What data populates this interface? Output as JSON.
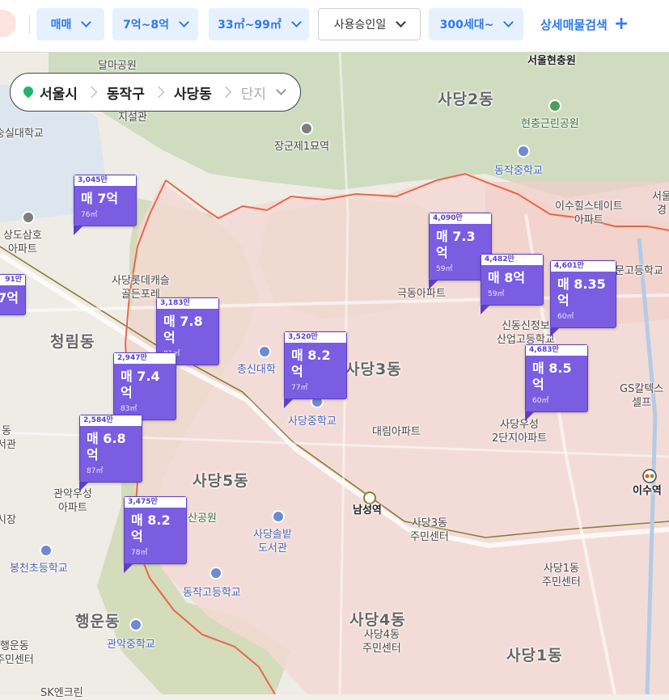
{
  "filters": {
    "deal_type": "매매",
    "price": "7억~8억",
    "area": "33㎡~99㎡",
    "approval": "사용승인일",
    "households": "300세대~",
    "detail_search": "상세매물검색"
  },
  "breadcrumb": {
    "city": "서울시",
    "district": "동작구",
    "dong": "사당동",
    "complex": "단지"
  },
  "map_labels": {
    "seoul_hyunchung": "서울현충원",
    "sadang2": "사당2동",
    "hyunchung_park": "현충근린공원",
    "janggunje": "장군제1묘역",
    "dongjak_ms": "동작중학교",
    "isu_hillstate": "이수힐스테이트\n아파트",
    "seoul_right": "서울\n경",
    "sangdo_samho": "상도삼호\n아파트",
    "sadang_lotte": "사당롯데캐슬\n골든포레",
    "geukdong": "극동아파트",
    "sindong_school": "신동신정보\n산업고등학교",
    "mungu": "문고등학교",
    "cheongnim": "청림동",
    "chongshin": "총신대학",
    "sadang3": "사당3동",
    "sadang_ms": "사당중학교",
    "daerim": "대림아파트",
    "sadang_usung": "사당우성\n2단지아파트",
    "gs": "GS칼텍스\n셀프",
    "seo_left": "동\n서관",
    "gwanak_usung": "관악우성\n아파트",
    "sadang5": "사당5동",
    "park": "산공원",
    "namseong": "남성역",
    "sadang3_center": "사당3동\n주민센터",
    "isu_station": "이수역",
    "si_jang": "시장",
    "sadang_library": "사당솔밭\n도서관",
    "bongcheon": "봉천초등학교",
    "sadang1_center": "사당1동\n주민센터",
    "dongjak_hs": "동작고등학교",
    "haengun": "행운동",
    "haengun_center": "행운동\n주민센터",
    "gwanak_ms": "관악중학교",
    "sadang4": "사당4동\n주민센터",
    "sadang4_area": "사당4동",
    "sadang1": "사당1동",
    "sk": "SK엔크린",
    "sungsil": "숭실대학교",
    "dalma": "달마공원",
    "jisul": "지설관"
  },
  "markers": [
    {
      "top": "3,045만",
      "price": "매 7억",
      "size": "76㎡"
    },
    {
      "top": "91만",
      "price": "7억",
      "size": ""
    },
    {
      "top": "3,183만",
      "price": "매 7.8억",
      "size": "81㎡"
    },
    {
      "top": "2,947만",
      "price": "매 7.4억",
      "size": "83㎡"
    },
    {
      "top": "2,584만",
      "price": "매 6.8억",
      "size": "87㎡"
    },
    {
      "top": "3,475만",
      "price": "매 8.2억",
      "size": "78㎡"
    },
    {
      "top": "3,520만",
      "price": "매 8.2억",
      "size": "77㎡"
    },
    {
      "top": "4,090만",
      "price": "매 7.3억",
      "size": "59㎡"
    },
    {
      "top": "4,482만",
      "price": "매 8억",
      "size": "59㎡"
    },
    {
      "top": "4,601만",
      "price": "매 8.35억",
      "size": "60㎡"
    },
    {
      "top": "4,683만",
      "price": "매 8.5억",
      "size": "60㎡"
    }
  ],
  "colors": {
    "accent": "#2f7ae5",
    "marker": "#7a5de0",
    "boundary": "#e8674a"
  }
}
